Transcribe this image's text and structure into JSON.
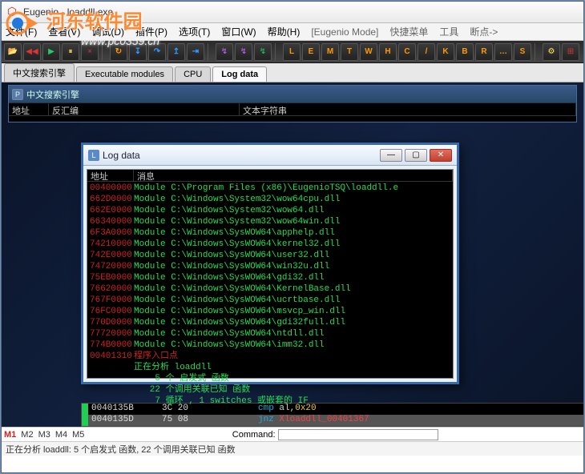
{
  "watermark": {
    "main": "河东软件园",
    "url": "www.pc0359.cn"
  },
  "title": "Eugenio - loaddll.exe",
  "menu": [
    "文件(F)",
    "查看(V)",
    "调试(D)",
    "插件(P)",
    "选项(T)",
    "窗口(W)",
    "帮助(H)",
    "[Eugenio Mode]",
    "快捷菜单",
    "工具",
    "断点->"
  ],
  "tabs": [
    "中文搜索引擎",
    "Executable modules",
    "CPU",
    "Log data"
  ],
  "active_tab": 3,
  "search_panel": {
    "title": "中文搜索引擎",
    "cols": [
      "地址",
      "反汇编",
      "文本字符串"
    ]
  },
  "log_window": {
    "title": "Log data",
    "cols": [
      "地址",
      "消息"
    ],
    "rows": [
      {
        "addr": "00400000",
        "cls": "mod",
        "msg": "Module C:\\Program Files (x86)\\EugenioTSQ\\loaddll.e"
      },
      {
        "addr": "662D0000",
        "cls": "mod",
        "msg": "Module C:\\Windows\\System32\\wow64cpu.dll"
      },
      {
        "addr": "662E0000",
        "cls": "mod",
        "msg": "Module C:\\Windows\\System32\\wow64.dll"
      },
      {
        "addr": "66340000",
        "cls": "mod",
        "msg": "Module C:\\Windows\\System32\\wow64win.dll"
      },
      {
        "addr": "6F3A0000",
        "cls": "mod",
        "msg": "Module C:\\Windows\\SysWOW64\\apphelp.dll"
      },
      {
        "addr": "74210000",
        "cls": "mod",
        "msg": "Module C:\\Windows\\SysWOW64\\kernel32.dll"
      },
      {
        "addr": "742E0000",
        "cls": "mod",
        "msg": "Module C:\\Windows\\SysWOW64\\user32.dll"
      },
      {
        "addr": "74720000",
        "cls": "mod",
        "msg": "Module C:\\Windows\\SysWOW64\\win32u.dll"
      },
      {
        "addr": "75EB0000",
        "cls": "mod",
        "msg": "Module C:\\Windows\\SysWOW64\\gdi32.dll"
      },
      {
        "addr": "76620000",
        "cls": "mod",
        "msg": "Module C:\\Windows\\SysWOW64\\KernelBase.dll"
      },
      {
        "addr": "767F0000",
        "cls": "mod",
        "msg": "Module C:\\Windows\\SysWOW64\\ucrtbase.dll"
      },
      {
        "addr": "76FC0000",
        "cls": "mod",
        "msg": "Module C:\\Windows\\SysWOW64\\msvcp_win.dll"
      },
      {
        "addr": "770D0000",
        "cls": "mod",
        "msg": "Module C:\\Windows\\SysWOW64\\gdi32full.dll"
      },
      {
        "addr": "77720000",
        "cls": "mod",
        "msg": "Module C:\\Windows\\SysWOW64\\ntdll.dll"
      },
      {
        "addr": "774B0000",
        "cls": "mod",
        "msg": "Module C:\\Windows\\SysWOW64\\imm32.dll"
      },
      {
        "addr": "00401310",
        "cls": "info",
        "msg": "程序入口点"
      },
      {
        "addr": "",
        "cls": "mod",
        "msg": "正在分析 loaddll"
      },
      {
        "addr": "",
        "cls": "mod",
        "msg": "    5 个 启发式 函数"
      },
      {
        "addr": "",
        "cls": "mod",
        "msg": "   22 个调用关联已知 函数"
      },
      {
        "addr": "",
        "cls": "mod",
        "msg": "    7 循环 , 1 switches 或嵌套的 IF"
      }
    ]
  },
  "asm": [
    {
      "addr": "0040135B",
      "bytes": "3C 20",
      "op": "cmp",
      "args": "al,",
      "num": "0x20",
      "sel": false
    },
    {
      "addr": "0040135D",
      "bytes": "75 08",
      "op": "jnz",
      "args": "",
      "lbl": "Xloaddll_00401367",
      "sel": true
    }
  ],
  "m_labels": [
    "M1",
    "M2",
    "M3",
    "M4",
    "M5"
  ],
  "command_label": "Command:",
  "status": "正在分析 loaddll: 5 个启发式 函数, 22 个调用关联已知 函数"
}
